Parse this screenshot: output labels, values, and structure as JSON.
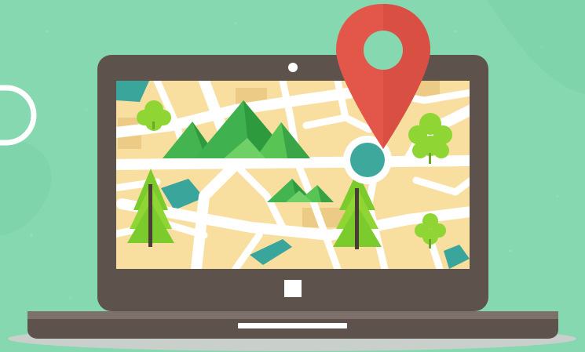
{
  "scene": {
    "subject": "laptop-with-map-and-location-pin",
    "icons": [
      "map-pin-icon",
      "mountain-icon",
      "pine-tree-icon",
      "bush-icon",
      "webcam-icon",
      "home-button-icon",
      "touchpad-icon"
    ]
  },
  "colors": {
    "background": "#86d8b0",
    "laptop_body": "#5e524d",
    "laptop_base": "#7e716b",
    "shadow": "#c9cfcb",
    "map_land": "#f8dfa0",
    "map_road": "#ffffff",
    "map_water": "#3aa59a",
    "pin": "#e3574b",
    "pin_dot": "#3ea89d",
    "mountain": "#3fb24f",
    "tree": "#7ccb2c"
  }
}
